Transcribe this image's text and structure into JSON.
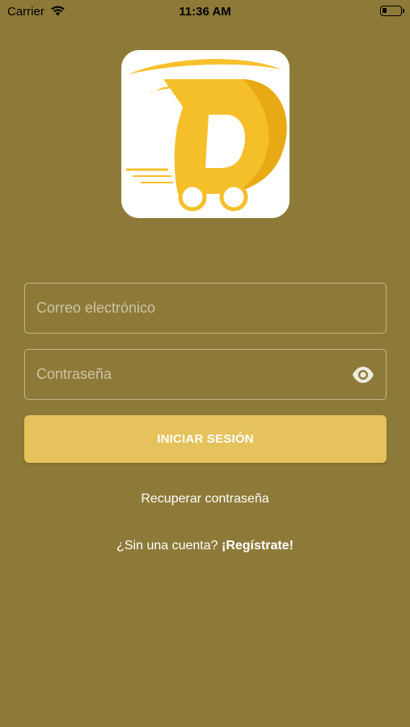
{
  "status_bar": {
    "carrier": "Carrier",
    "time": "11:36 AM",
    "wifi_icon": "wifi-icon",
    "battery_icon": "battery-low-icon"
  },
  "logo": {
    "icon": "delivery-truck-d-logo",
    "accent_color": "#f5c02e",
    "accent_dark": "#e6a916"
  },
  "form": {
    "email_placeholder": "Correo electrónico",
    "email_value": "",
    "password_placeholder": "Contraseña",
    "password_value": "",
    "show_password_icon": "eye-icon",
    "login_button_label": "INICIAR SESIÓN"
  },
  "links": {
    "forgot_password": "Recuperar contraseña",
    "signup_prompt": "¿Sin una cuenta? ",
    "signup_link": "¡Regístrate!"
  },
  "colors": {
    "background": "#8e7a38",
    "button": "#e5c25c"
  }
}
